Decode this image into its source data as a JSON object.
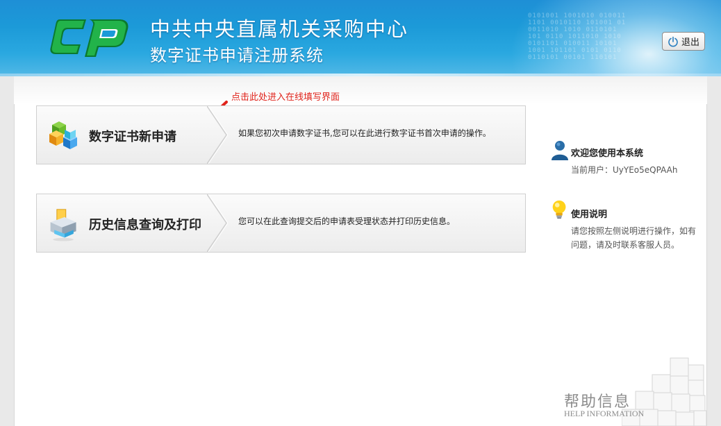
{
  "header": {
    "org_name": "中共中央直属机关采购中心",
    "system_name": "数字证书申请注册系统",
    "logout_label": "退出",
    "decor_digits": "0101001 1001010 010011\n1101 0010110 101001 01\n0011010 1010 0110101\n101 0110 1011010 1010\n0101101 010011 10101\n1001 101101 0101 0110\n0110101 00101 110101"
  },
  "main": {
    "hint_text": "点击此处进入在线填写界面",
    "cards": [
      {
        "label": "数字证书新申请",
        "description": "如果您初次申请数字证书,您可以在此进行数字证书首次申请的操作。"
      },
      {
        "label": "历史信息查询及打印",
        "description": "您可以在此查询提交后的申请表受理状态并打印历史信息。"
      }
    ]
  },
  "sidebar": {
    "welcome_title": "欢迎您使用本系统",
    "current_user_label": "当前用户：UyYEo5eQPAAh",
    "instructions_title": "使用说明",
    "instructions_text": "请您按照左侧说明进行操作，如有问题，请及时联系客服人员。"
  },
  "help": {
    "title_cn": "帮助信息",
    "title_en": "HELP INFORMATION"
  },
  "colors": {
    "header_blue": "#1c9ad8",
    "hint_red": "#e0231b",
    "logo_green": "#1fae3f"
  }
}
